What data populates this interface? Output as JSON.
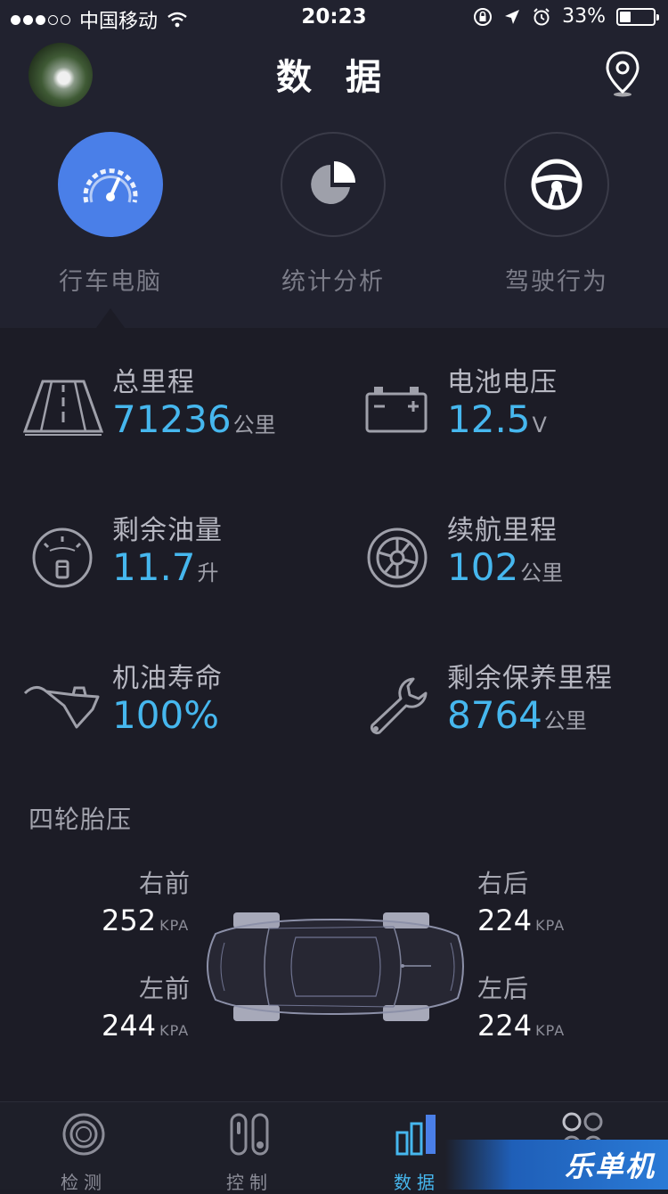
{
  "status_bar": {
    "carrier": "中国移动",
    "time": "20:23",
    "battery": "33%",
    "battery_level": 0.33
  },
  "header": {
    "title": "数 据"
  },
  "tabs": [
    {
      "label": "行车电脑",
      "icon": "speedometer-icon",
      "active": true
    },
    {
      "label": "统计分析",
      "icon": "pie-chart-icon",
      "active": false
    },
    {
      "label": "驾驶行为",
      "icon": "steering-wheel-icon",
      "active": false
    }
  ],
  "stats": [
    {
      "name": "总里程",
      "value": "71236",
      "unit": "公里",
      "icon": "road-icon"
    },
    {
      "name": "电池电压",
      "value": "12.5",
      "unit": "V",
      "icon": "battery-icon"
    },
    {
      "name": "剩余油量",
      "value": "11.7",
      "unit": "升",
      "icon": "fuel-gauge-icon"
    },
    {
      "name": "续航里程",
      "value": "102",
      "unit": "公里",
      "icon": "wheel-icon"
    },
    {
      "name": "机油寿命",
      "value": "100%",
      "unit": "",
      "icon": "oil-can-icon"
    },
    {
      "name": "剩余保养里程",
      "value": "8764",
      "unit": "公里",
      "icon": "wrench-icon"
    }
  ],
  "tire_pressure": {
    "title": "四轮胎压",
    "unit": "KPA",
    "right_front": {
      "label": "右前",
      "value": "252"
    },
    "left_front": {
      "label": "左前",
      "value": "244"
    },
    "right_rear": {
      "label": "右后",
      "value": "224"
    },
    "left_rear": {
      "label": "左后",
      "value": "224"
    }
  },
  "nav": [
    {
      "label": "检测",
      "icon": "detect-icon",
      "active": false
    },
    {
      "label": "控制",
      "icon": "control-icon",
      "active": false
    },
    {
      "label": "数据",
      "icon": "bar-chart-icon",
      "active": true
    },
    {
      "label": "",
      "icon": "more-icon",
      "active": false
    }
  ],
  "watermark": "乐单机",
  "colors": {
    "accent": "#46b7ee",
    "tab_active": "#4a7fe8",
    "background": "#1c1c26",
    "header_bg": "#21222f"
  }
}
